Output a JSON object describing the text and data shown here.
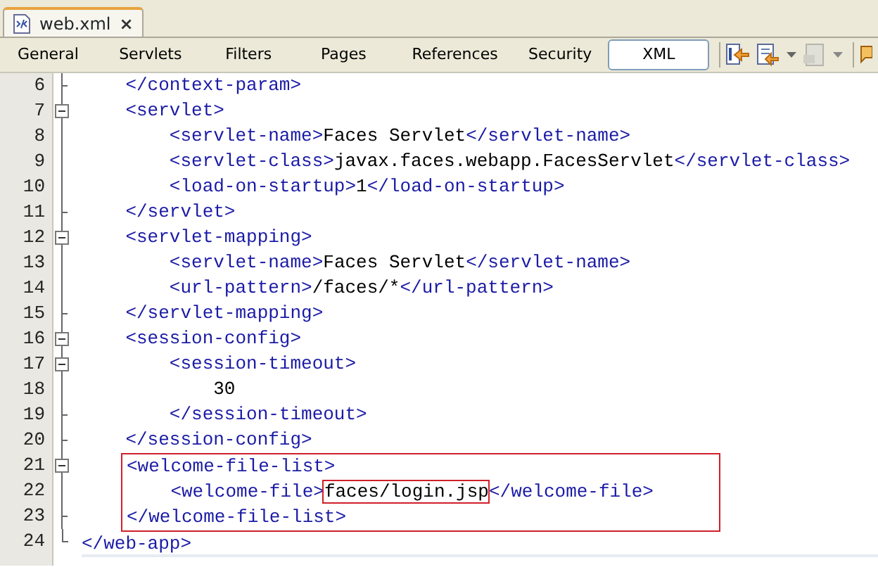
{
  "file_tab": {
    "title": "web.xml",
    "close": "×"
  },
  "view_tabs": [
    {
      "label": "General",
      "selected": false
    },
    {
      "label": "Servlets",
      "selected": false
    },
    {
      "label": "Filters",
      "selected": false
    },
    {
      "label": "Pages",
      "selected": false
    },
    {
      "label": "References",
      "selected": false
    },
    {
      "label": "Security",
      "selected": false
    },
    {
      "label": "XML",
      "selected": true
    }
  ],
  "editor": {
    "lines": [
      {
        "number": "6",
        "kind": "tick",
        "in_box": false,
        "segments": [
          {
            "kind": "tag",
            "text": "    </context-param>"
          }
        ]
      },
      {
        "number": "7",
        "kind": "collapse",
        "in_box": false,
        "segments": [
          {
            "kind": "tag",
            "text": "    <servlet>"
          }
        ]
      },
      {
        "number": "8",
        "kind": "none",
        "in_box": false,
        "segments": [
          {
            "kind": "tag",
            "text": "        <servlet-name>"
          },
          {
            "kind": "text",
            "text": "Faces Servlet"
          },
          {
            "kind": "tag",
            "text": "</servlet-name>"
          }
        ]
      },
      {
        "number": "9",
        "kind": "none",
        "in_box": false,
        "segments": [
          {
            "kind": "tag",
            "text": "        <servlet-class>"
          },
          {
            "kind": "text",
            "text": "javax.faces.webapp.FacesServlet"
          },
          {
            "kind": "tag",
            "text": "</servlet-class>"
          }
        ]
      },
      {
        "number": "10",
        "kind": "none",
        "in_box": false,
        "segments": [
          {
            "kind": "tag",
            "text": "        <load-on-startup>"
          },
          {
            "kind": "text",
            "text": "1"
          },
          {
            "kind": "tag",
            "text": "</load-on-startup>"
          }
        ]
      },
      {
        "number": "11",
        "kind": "tick",
        "in_box": false,
        "segments": [
          {
            "kind": "tag",
            "text": "    </servlet>"
          }
        ]
      },
      {
        "number": "12",
        "kind": "collapse",
        "in_box": false,
        "segments": [
          {
            "kind": "tag",
            "text": "    <servlet-mapping>"
          }
        ]
      },
      {
        "number": "13",
        "kind": "none",
        "in_box": false,
        "segments": [
          {
            "kind": "tag",
            "text": "        <servlet-name>"
          },
          {
            "kind": "text",
            "text": "Faces Servlet"
          },
          {
            "kind": "tag",
            "text": "</servlet-name>"
          }
        ]
      },
      {
        "number": "14",
        "kind": "none",
        "in_box": false,
        "segments": [
          {
            "kind": "tag",
            "text": "        <url-pattern>"
          },
          {
            "kind": "text",
            "text": "/faces/*"
          },
          {
            "kind": "tag",
            "text": "</url-pattern>"
          }
        ]
      },
      {
        "number": "15",
        "kind": "tick",
        "in_box": false,
        "segments": [
          {
            "kind": "tag",
            "text": "    </servlet-mapping>"
          }
        ]
      },
      {
        "number": "16",
        "kind": "collapse",
        "in_box": false,
        "segments": [
          {
            "kind": "tag",
            "text": "    <session-config>"
          }
        ]
      },
      {
        "number": "17",
        "kind": "collapse",
        "in_box": false,
        "segments": [
          {
            "kind": "tag",
            "text": "        <session-timeout>"
          }
        ]
      },
      {
        "number": "18",
        "kind": "none",
        "in_box": false,
        "segments": [
          {
            "kind": "text",
            "text": "            30"
          }
        ]
      },
      {
        "number": "19",
        "kind": "tick",
        "in_box": false,
        "segments": [
          {
            "kind": "tag",
            "text": "        </session-timeout>"
          }
        ]
      },
      {
        "number": "20",
        "kind": "tick",
        "in_box": false,
        "segments": [
          {
            "kind": "tag",
            "text": "    </session-config>"
          }
        ]
      },
      {
        "number": "21",
        "kind": "collapse",
        "in_box": true,
        "segments": [
          {
            "kind": "tag",
            "text": "<welcome-file-list>"
          }
        ]
      },
      {
        "number": "22",
        "kind": "none",
        "in_box": true,
        "segments": [
          {
            "kind": "tag",
            "text": "    <welcome-file>"
          },
          {
            "kind": "text",
            "text": "faces/login.jsp",
            "boxed": true
          },
          {
            "kind": "tag",
            "text": "</welcome-file>"
          }
        ]
      },
      {
        "number": "23",
        "kind": "tick",
        "in_box": true,
        "segments": [
          {
            "kind": "tag",
            "text": "</welcome-file-list>"
          }
        ]
      },
      {
        "number": "24",
        "kind": "corner",
        "in_box": false,
        "segments": [
          {
            "kind": "tag",
            "text": "</web-app>"
          }
        ]
      }
    ]
  }
}
